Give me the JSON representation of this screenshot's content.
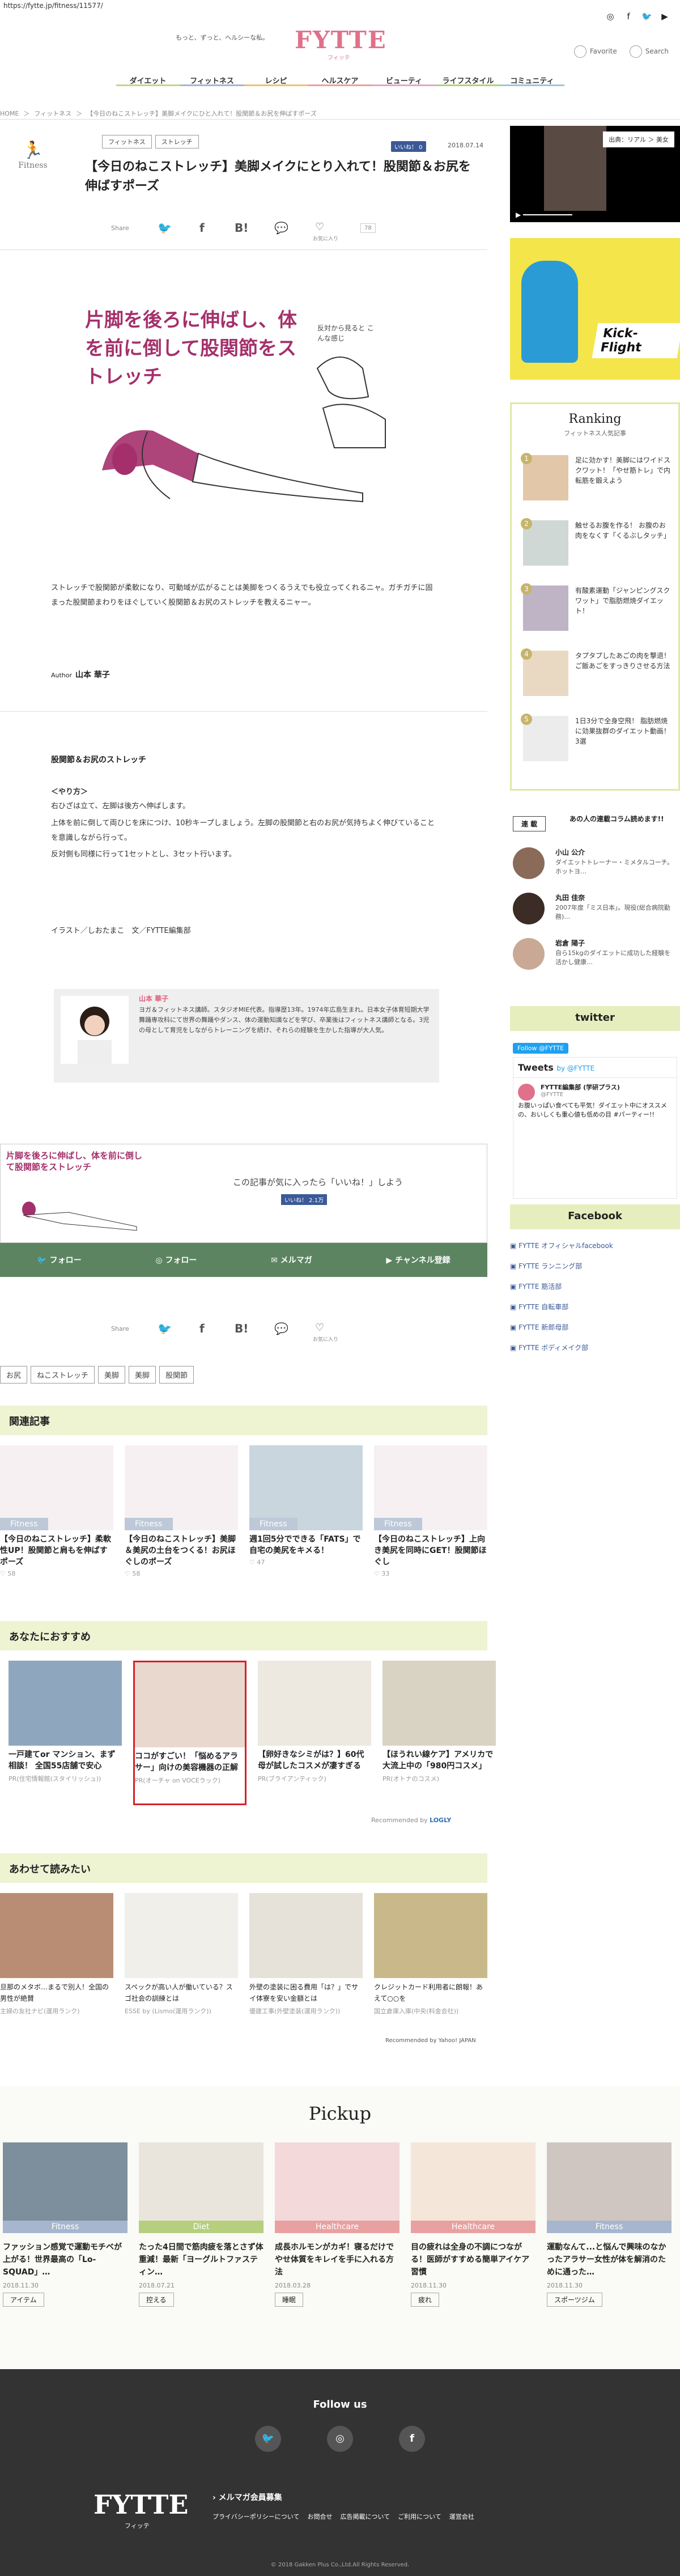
{
  "url": "https://fytte.jp/fitness/11577/",
  "header": {
    "tagline": "もっと、ずっと、ヘルシーな私。",
    "logo": "FYTTE",
    "logo_sub": "フィッテ",
    "favorite": "Favorite",
    "search": "Search"
  },
  "nav": [
    "ダイエット",
    "フィットネス",
    "レシピ",
    "ヘルスケア",
    "ビューティ",
    "ライフスタイル",
    "コミュニティ"
  ],
  "breadcrumb": [
    "HOME",
    "＞",
    "フィットネス",
    "＞",
    "【今日のねこストレッチ】美脚メイクにひと入れて！股関節＆お尻を伸ばすポーズ"
  ],
  "article": {
    "category": "Fitness",
    "tags": [
      "フィットネス",
      "ストレッチ"
    ],
    "like_label": "いいね！ 0",
    "date": "2018.07.14",
    "title": "【今日のねこストレッチ】美脚メイクにとり入れて！股関節＆お尻を伸ばすポーズ",
    "share_label": "Share",
    "okiniiri": "お気に入り",
    "count": "78",
    "hero_text": "片脚を後ろに伸ばし、体を前に倒して股関節をストレッチ",
    "hero_note": "反対から見ると こんな感じ",
    "intro": "ストレッチで股関節が柔軟になり、可動域が広がることは美脚をつくるうえでも役立ってくれるニャ。ガチガチに固まった股関節まわりをほぐしていく股関節＆お尻のストレッチを教えるニャー。",
    "author_label": "Author",
    "author_name": "山本 華子",
    "sub_heading": "股関節＆お尻のストレッチ",
    "howto_title": "＜やり方＞",
    "steps": [
      "右ひざは立て、左脚は後方へ伸ばします。",
      "上体を前に倒して両ひじを床につけ、10秒キープしましょう。左脚の股関節と右のお尻が気持ちよく伸びていることを意識しながら行って。",
      "反対側も同様に行って1セットとし、3セット行います。"
    ],
    "credit": "イラスト／しおたまこ　文／FYTTE編集部",
    "profile_name": "山本 華子",
    "profile_text": "ヨガ＆フィットネス講師。スタジオMIE代表。指導歴13年。1974年広島生まれ。日本女子体育短期大学舞踊専攻科にて世界の舞踊やダンス、体の運動知識などを学び、卒業後はフィットネス講師となる。3児の母として育児をしながらトレーニングを続け、それらの経験を生かした指導が大人気。"
  },
  "like_box": {
    "text": "この記事が気に入ったら「いいね！」しよう",
    "button": "いいね！ 2.1万"
  },
  "follow_bar": [
    "フォロー",
    "フォロー",
    "メルマガ",
    "チャンネル登録"
  ],
  "tag_row": [
    "お尻",
    "ねこストレッチ",
    "美脚",
    "美脚",
    "股関節"
  ],
  "related": {
    "title": "関連記事",
    "items": [
      {
        "cat": "Fitness",
        "title": "【今日のねこストレッチ】柔軟性UP！股関節と肩もを伸ばすポーズ",
        "likes": "58"
      },
      {
        "cat": "Fitness",
        "title": "【今日のねこストレッチ】美脚＆美尻の土台をつくる！お尻ほぐしのポーズ",
        "likes": "58"
      },
      {
        "cat": "Fitness",
        "title": "週1回5分でできる「FATS」で自宅の美尻をキメる！",
        "likes": "47"
      },
      {
        "cat": "Fitness",
        "title": "【今日のねこストレッチ】上向き美尻を同時にGET！股関節ほぐし",
        "likes": "33"
      }
    ]
  },
  "recommend": {
    "title": "あなたにおすすめ",
    "items": [
      {
        "title": "一戸建てor マンション、まず相談！ 全国55店舗で安心",
        "src": "PR(住宅情報館(スタイリッシュ))"
      },
      {
        "title": "ココがすごい！「悩めるアラサー」向けの美容機器の正解",
        "src": "PR(オーチャ on VOCEラック)"
      },
      {
        "title": "【卵好きなシミがは？】60代母が試したコスメが凄すぎる",
        "src": "PR(ブライアンティック)"
      },
      {
        "title": "【ほうれい線ケア】アメリカで大流上中の「980円コスメ」",
        "src": "PR(オトナのコスメ)"
      }
    ],
    "rec_by": "Recommended by",
    "logly": "LOGLY"
  },
  "also_read": {
    "title": "あわせて読みたい",
    "items": [
      {
        "title": "旦那のメタボ…まるで別人！全国の男性が絶賛",
        "src": "主婦の友社ナビ(運用ランク)"
      },
      {
        "title": "スペックが高い人が働いている？スゴ社会の訓練とは",
        "src": "ESSE by (Lismo(運用ランク))"
      },
      {
        "title": "外壁の塗装に困る費用「は？」でサイ体寮を安い金額とは",
        "src": "優建工事(外壁塗装(運用ランク))"
      },
      {
        "title": "クレジットカード利用者に朗報！あえて○○を",
        "src": "国立倉庫入庫(中央(料金会社))"
      }
    ],
    "rec_by": "Recommended by Yahoo! JAPAN"
  },
  "sidebar": {
    "video_caption": "出典：リアル ＞ 美女",
    "ad_brand": "Kick-Flight",
    "ranking_title": "Ranking",
    "ranking_sub": "フィットネス人気記事",
    "ranking": [
      {
        "n": "1",
        "text": "足に効かす！美脚にはワイドスクワット！「やせ筋トレ」で内転筋を鍛えよう"
      },
      {
        "n": "2",
        "text": "触せるお腹を作る！ お腹のお肉をなくす「くるぶしタッチ」"
      },
      {
        "n": "3",
        "text": "有酸素運動「ジャンピングスクワット」で脂肪燃焼ダイエット！"
      },
      {
        "n": "4",
        "text": "タプタプしたあごの肉を撃退！ ご飯あごをすっきりさせる方法"
      },
      {
        "n": "5",
        "text": "1日3分で全身空飛！ 脂肪燃焼に効果抜群のダイエット動画！3選"
      }
    ],
    "series_label": "連 載",
    "series_title": "あの人の連載コラム読めます!!",
    "people": [
      {
        "name": "小山 公介",
        "text": "ダイエットトレーナー・ミメタルコーチ。ホットヨ…"
      },
      {
        "name": "丸田 佳奈",
        "text": "2007年度「ミス日本」。現役(総合病院勤務)…"
      },
      {
        "name": "岩倉 陽子",
        "text": "自ら15kgのダイエットに成功した経験を活かし健康…"
      }
    ],
    "twitter_head": "twitter",
    "tw_follow": "Follow @FYTTE",
    "tweets_by": "Tweets",
    "tweets_by_user": "by @FYTTE",
    "tw_name": "FYTTE編集部 (学研プラス)",
    "tw_handle": "@FYTTE",
    "tw_text": "お腹いっぱい食べても平気！ダイエット中にオススメの、おいしくも重心値も低めの目 #パーティー!!",
    "facebook_head": "Facebook",
    "fb_links": [
      "FYTTE オフィシャルfacebook",
      "FYTTE ランニング部",
      "FYTTE 筋活部",
      "FYTTE 自転車部",
      "FYTTE 新郎母部",
      "FYTTE ボディメイク部"
    ]
  },
  "pickup": {
    "title": "Pickup",
    "items": [
      {
        "cat": "Fitness",
        "cat_color": "#a6b6cf",
        "title": "ファッション感覚で運動モチベが上がる！世界最高の「Lo-SQUAD」…",
        "date": "2018.11.30",
        "tag": "アイテム"
      },
      {
        "cat": "Diet",
        "cat_color": "#b5cf7f",
        "title": "たった4日間で筋肉疲を落とさず体重減！最新「ヨーグルトファスティン…",
        "date": "2018.07.21",
        "tag": "控える"
      },
      {
        "cat": "Healthcare",
        "cat_color": "#e9a0a0",
        "title": "成長ホルモンがカギ！寝るだけでやせ体質をキレイを手に入れる方法",
        "date": "2018.03.28",
        "tag": "睡眠"
      },
      {
        "cat": "Healthcare",
        "cat_color": "#e9a0a0",
        "title": "目の疲れは全身の不調につながる！医師がすすめる簡単アイケア習慣",
        "date": "2018.11.30",
        "tag": "疲れ"
      },
      {
        "cat": "Fitness",
        "cat_color": "#a6b6cf",
        "title": "運動なんて...と悩んで興味のなかったアラサー女性が体を解消のために通った…",
        "date": "2018.11.30",
        "tag": "スポーツジム"
      }
    ]
  },
  "footer": {
    "follow_us": "Follow us",
    "logo": "FYTTE",
    "logo_sub": "フィッテ",
    "mailmag": "メルマガ会員募集",
    "links": [
      "プライバシーポリシーについて",
      "お問合せ",
      "広告掲載について",
      "ご利用について",
      "運営会社"
    ],
    "copyright": "© 2018 Gakken Plus Co.,Ltd.All Rights Reserved."
  },
  "colors": {
    "brand_pink": "#e0718a",
    "follow_green": "#5c8461",
    "section_bg": "#eef3d2",
    "rank_border": "#dfe8a7"
  }
}
